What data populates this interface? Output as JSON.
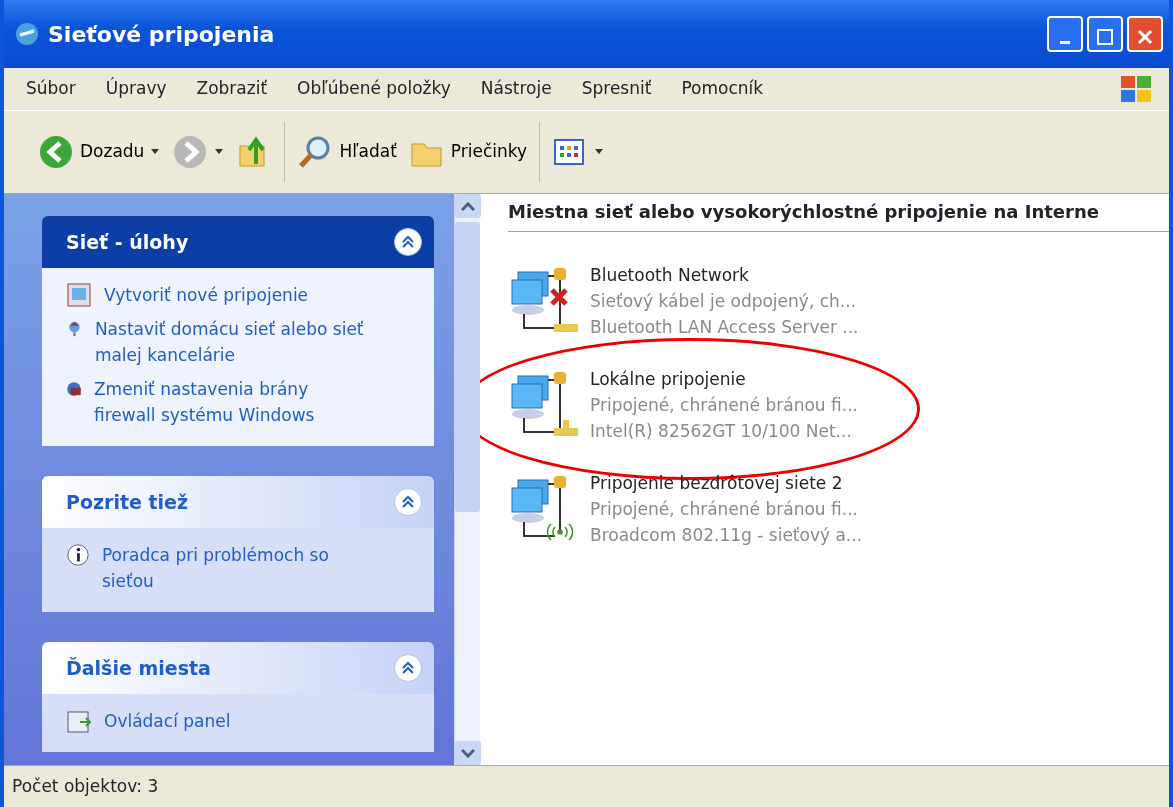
{
  "window": {
    "title": "Sieťové pripojenia"
  },
  "menu": [
    "Súbor",
    "Úpravy",
    "Zobraziť",
    "Obľúbené položky",
    "Nástroje",
    "Spresniť",
    "Pomocník"
  ],
  "toolbar": [
    {
      "kind": "back",
      "label": "Dozadu"
    },
    {
      "kind": "forward"
    },
    {
      "kind": "up"
    },
    {
      "kind": "search",
      "label": "Hľadať"
    },
    {
      "kind": "folders",
      "label": "Priečinky"
    },
    {
      "kind": "views"
    }
  ],
  "sidebar": {
    "panels": [
      {
        "title": "Sieť - úlohy",
        "primary": true,
        "items": [
          {
            "kind": "new",
            "label": "Vytvoriť nové pripojenie"
          },
          {
            "kind": "home",
            "label": "Nastaviť domácu sieť alebo sieť malej kancelárie"
          },
          {
            "kind": "firewall",
            "label": "Zmeniť nastavenia brány firewall systému Windows"
          }
        ]
      },
      {
        "title": "Pozrite tiež",
        "primary": false,
        "items": [
          {
            "kind": "info",
            "label": "Poradca pri problémoch so sieťou"
          }
        ]
      },
      {
        "title": "Ďalšie miesta",
        "primary": false,
        "items": [
          {
            "kind": "panel",
            "label": "Ovládací panel"
          }
        ]
      }
    ]
  },
  "content": {
    "group_title": "Miestna sieť alebo vysokorýchlostné pripojenie na Interne",
    "connections": [
      {
        "kind": "disconnected",
        "name": "Bluetooth Network",
        "status": "Sieťový kábel je odpojený, ch...",
        "device": "Bluetooth LAN Access Server ...",
        "highlighted": false
      },
      {
        "kind": "wired",
        "name": "Lokálne pripojenie",
        "status": "Pripojené, chránené bránou fi...",
        "device": "Intel(R) 82562GT 10/100 Net...",
        "highlighted": true
      },
      {
        "kind": "wireless",
        "name": "Pripojenie bezdrôtovej siete 2",
        "status": "Pripojené, chránené bránou fi...",
        "device": "Broadcom 802.11g - sieťový a...",
        "highlighted": false
      }
    ]
  },
  "status_bar": {
    "text": "Počet objektov: 3"
  }
}
